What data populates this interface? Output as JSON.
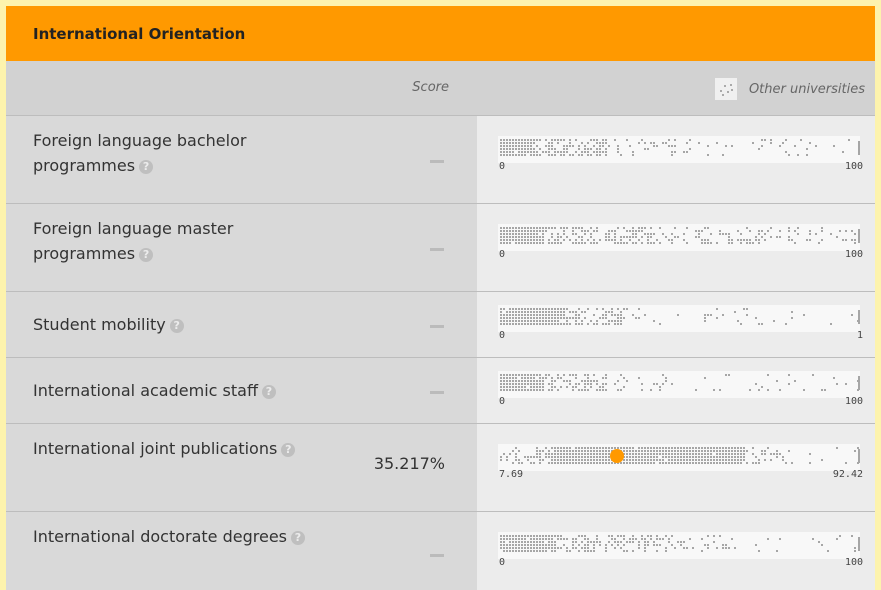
{
  "section": {
    "title": "International Orientation",
    "score_header": "Score",
    "others_header": "Other universities",
    "others_icon": "scatter-plot-icon"
  },
  "colors": {
    "header_bg": "#ff9900",
    "highlight_dot": "#ff9900",
    "dots": "#a6a6a6"
  },
  "rows": [
    {
      "label": "Foreign language bachelor programmes",
      "score": "",
      "min": "0",
      "max": "100",
      "highlight": null
    },
    {
      "label": "Foreign language master programmes",
      "score": "",
      "min": "0",
      "max": "100",
      "highlight": null
    },
    {
      "label": "Student mobility",
      "score": "",
      "min": "0",
      "max": "1",
      "highlight": null
    },
    {
      "label": "International academic staff",
      "score": "",
      "min": "0",
      "max": "100",
      "highlight": null
    },
    {
      "label": "International joint publications",
      "score": "35.217%",
      "min": "7.69",
      "max": "92.42",
      "highlight": 35.217
    },
    {
      "label": "International doctorate degrees",
      "score": "",
      "min": "0",
      "max": "100",
      "highlight": null
    }
  ],
  "help_icon": "?"
}
